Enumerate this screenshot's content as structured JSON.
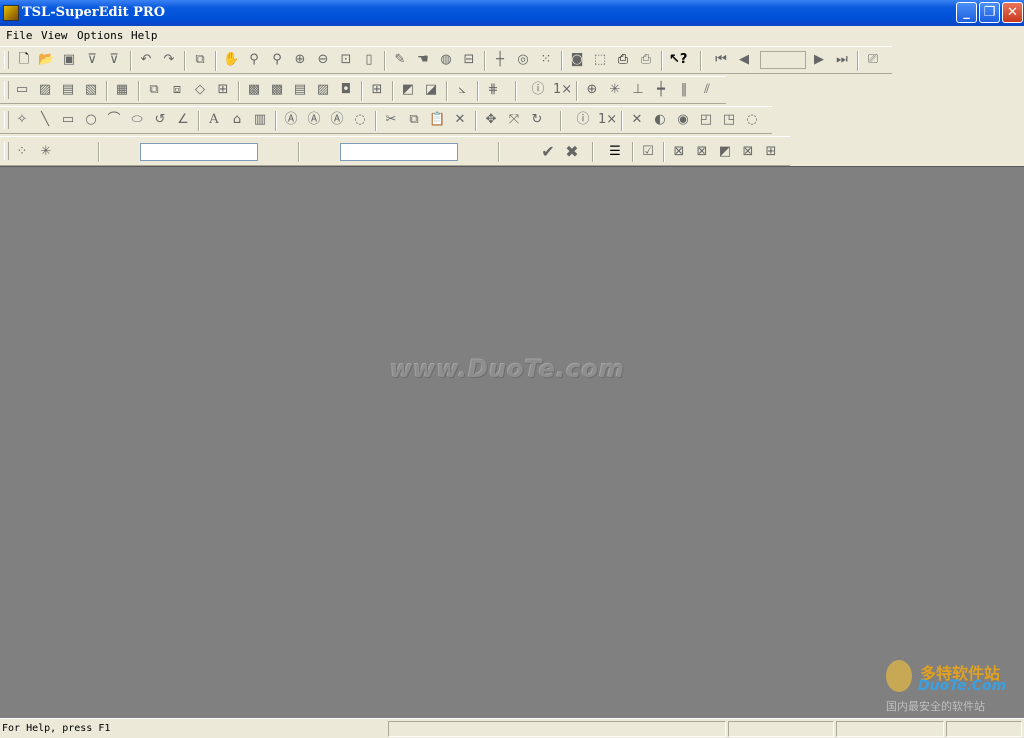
{
  "window": {
    "title": "TSL-SuperEdit PRO",
    "controls": {
      "minimize": "_",
      "restore": "❐",
      "close": "✕"
    }
  },
  "menu": {
    "items": [
      {
        "label": "File"
      },
      {
        "label": "View"
      },
      {
        "label": "Options"
      },
      {
        "label": "Help"
      }
    ]
  },
  "toolbars": {
    "row1": [
      "new-file-icon",
      "open-folder-icon",
      "save-icon",
      "filter-icon",
      "filter-edit-icon",
      "undo-icon",
      "redo-icon",
      "copy-icon",
      "pan-hand-icon",
      "zoom-icon",
      "zoom-window-icon",
      "zoom-in-icon",
      "zoom-out-icon",
      "zoom-extents-icon",
      "page-icon",
      "pencil-icon",
      "hand-icon",
      "balloon-icon",
      "layout-icon",
      "crosshair-icon",
      "circle-select-icon",
      "dots-select-icon",
      "fill-icon",
      "frame-icon",
      "print-icon",
      "print-preview-icon",
      "context-help-icon",
      "first-page-icon",
      "prev-page-icon",
      "next-page-icon",
      "last-page-icon",
      "settings-icon"
    ],
    "row2_count": 30,
    "row3_count": 32,
    "row4": {
      "confirm": "✔",
      "cancel": "✖"
    }
  },
  "workspace": {
    "watermark": "www.DuoTe.com",
    "corner_logo": {
      "line1": "多特软件站",
      "line2": "DuoTe.Com",
      "line3": "国内最安全的软件站"
    }
  },
  "status": {
    "text": "For Help, press F1"
  },
  "colors": {
    "titlebar": "#0a5ade",
    "chrome": "#ece9d8",
    "workspace": "#808080"
  }
}
